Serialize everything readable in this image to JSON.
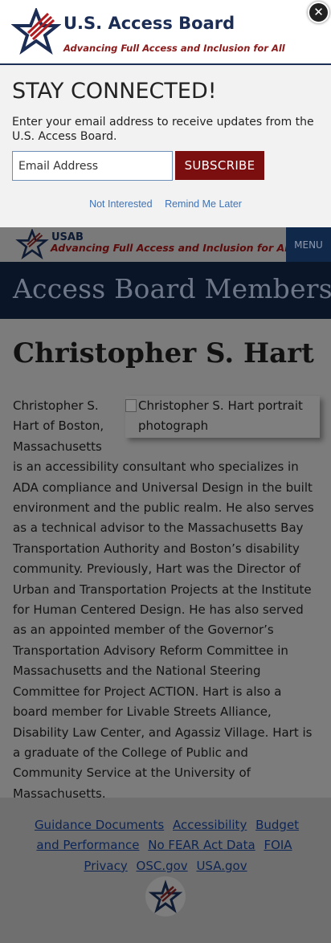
{
  "modal": {
    "brand_name": "U.S. Access Board",
    "brand_tagline": "Advancing Full Access and Inclusion for All",
    "close_icon": "close-icon",
    "title": "STAY CONNECTED!",
    "description": "Enter your email address to receive updates from the U.S. Access Board.",
    "email_placeholder": "Email Address",
    "subscribe_label": "SUBSCRIBE",
    "not_interested": "Not Interested",
    "remind_later": "Remind Me Later"
  },
  "header": {
    "short_name": "USAB",
    "tagline": "Advancing Full Access and Inclusion for All",
    "menu_label": "MENU"
  },
  "banner": {
    "title": "Access Board Members"
  },
  "main": {
    "name": "Christopher S. Hart",
    "portrait_alt": "Christopher S. Hart portrait photograph",
    "bio": "Christopher S. Hart of Boston, Massachusetts is an accessibility consultant who specializes in ADA compliance and Universal Design in the built environment and the public realm. He also serves as a technical advisor to the Massachusetts Bay Transportation Authority and Boston’s disability community. Previously, Hart was the Director of Urban and Transportation Projects at the Institute for Human Centered Design. He has also served as an appointed member of the Governor’s Transportation Advisory Reform Committee in Massachusetts and the National Steering Committee for Project ACTION. Hart is also a board member for Livable Streets Alliance, Disability Law Center, and Agassiz Village. Hart is a graduate of the College of Public and Community Service at the University of Massachusetts."
  },
  "footer": {
    "links": [
      "Guidance Documents",
      "Accessibility",
      "Budget and Performance",
      "No FEAR Act Data",
      "FOIA",
      "Privacy",
      "OSC.gov",
      "USA.gov"
    ]
  },
  "colors": {
    "navy": "#1b2d54",
    "brand_red": "#7b0f10",
    "link_blue": "#3f72b5"
  }
}
